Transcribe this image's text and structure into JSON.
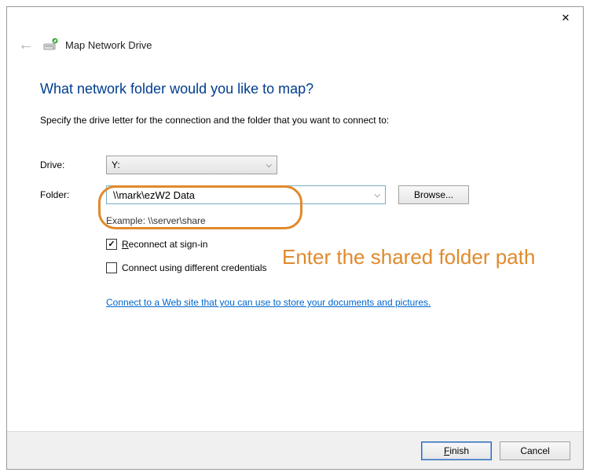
{
  "window": {
    "title": "Map Network Drive"
  },
  "heading": "What network folder would you like to map?",
  "subtext": "Specify the drive letter for the connection and the folder that you want to connect to:",
  "labels": {
    "drive": "Drive:",
    "folder": "Folder:"
  },
  "drive": {
    "value": "Y:"
  },
  "folder": {
    "value": "\\\\mark\\ezW2 Data"
  },
  "buttons": {
    "browse": "Browse...",
    "finish_prefix": "",
    "finish_underlined": "F",
    "finish_rest": "inish",
    "cancel": "Cancel"
  },
  "example": "Example: \\\\server\\share",
  "checkboxes": {
    "reconnect_prefix": "",
    "reconnect_underlined": "R",
    "reconnect_rest": "econnect at sign-in",
    "reconnect_checked": true,
    "diffcred": "Connect using different credentials",
    "diffcred_checked": false
  },
  "link": "Connect to a Web site that you can use to store your documents and pictures",
  "annotation": {
    "text": "Enter the shared folder path"
  }
}
